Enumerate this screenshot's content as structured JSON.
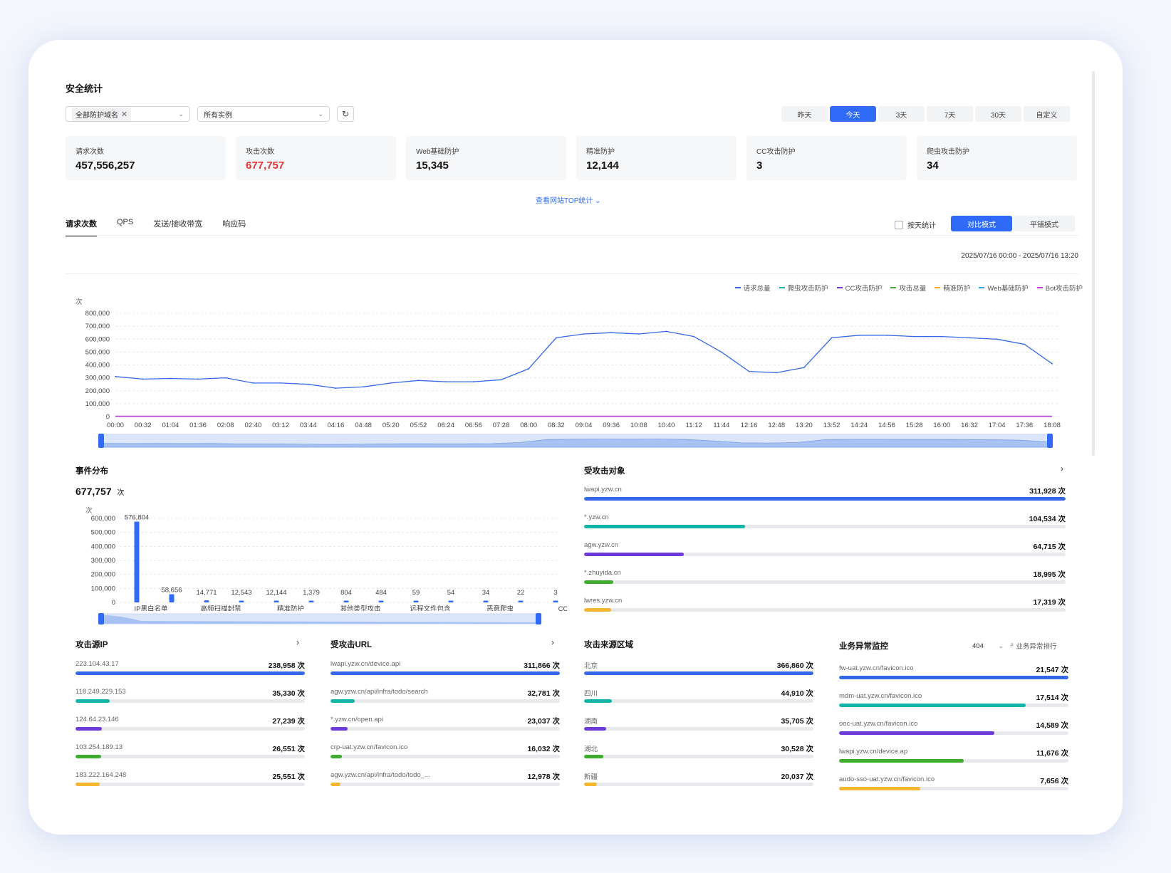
{
  "title": "安全统计",
  "filters": {
    "domain_tag": "全部防护域名",
    "instance": "所有实例"
  },
  "ranges": [
    {
      "label": "昨天",
      "active": false
    },
    {
      "label": "今天",
      "active": true
    },
    {
      "label": "3天",
      "active": false
    },
    {
      "label": "7天",
      "active": false
    },
    {
      "label": "30天",
      "active": false
    },
    {
      "label": "自定义",
      "active": false
    }
  ],
  "cards": [
    {
      "label": "请求次数",
      "value": "457,556,257",
      "red": false
    },
    {
      "label": "攻击次数",
      "value": "677,757",
      "red": true
    },
    {
      "label": "Web基础防护",
      "value": "15,345",
      "red": false
    },
    {
      "label": "精准防护",
      "value": "12,144",
      "red": false
    },
    {
      "label": "CC攻击防护",
      "value": "3",
      "red": false
    },
    {
      "label": "爬虫攻击防护",
      "value": "34",
      "red": false
    }
  ],
  "top_link": "查看网站TOP统计 ⌄",
  "tabs": [
    {
      "label": "请求次数",
      "active": true
    },
    {
      "label": "QPS",
      "active": false
    },
    {
      "label": "发送/接收带宽",
      "active": false
    },
    {
      "label": "响应码",
      "active": false
    }
  ],
  "by_day_label": "按天统计",
  "modes": [
    {
      "label": "对比模式",
      "active": true
    },
    {
      "label": "平铺模式",
      "active": false
    }
  ],
  "date_range": "2025/07/16 00:00 - 2025/07/16 13:20",
  "colors": {
    "accent": "#2f6bf6",
    "red": "#e23535"
  },
  "chart_data": [
    {
      "type": "line",
      "ylabel": "次",
      "ylim": [
        0,
        800000
      ],
      "yticks": [
        "800,000",
        "700,000",
        "600,000",
        "500,000",
        "400,000",
        "300,000",
        "200,000",
        "100,000",
        "0"
      ],
      "categories": [
        "00:00",
        "00:32",
        "01:04",
        "01:36",
        "02:08",
        "02:40",
        "03:12",
        "03:44",
        "04:16",
        "04:48",
        "05:20",
        "05:52",
        "06:24",
        "06:56",
        "07:28",
        "08:00",
        "08:32",
        "09:04",
        "09:36",
        "10:08",
        "10:40",
        "11:12",
        "11:44",
        "12:16",
        "12:48",
        "13:20",
        "13:52",
        "14:24",
        "14:56",
        "15:28",
        "16:00",
        "16:32",
        "17:04",
        "17:36",
        "18:08"
      ],
      "legend": [
        {
          "name": "请求总量",
          "color": "#3568e8"
        },
        {
          "name": "爬虫攻击防护",
          "color": "#13b5a8"
        },
        {
          "name": "CC攻击防护",
          "color": "#6c3bd8"
        },
        {
          "name": "攻击总量",
          "color": "#3fae2f"
        },
        {
          "name": "精准防护",
          "color": "#f5a623"
        },
        {
          "name": "Web基础防护",
          "color": "#2fa6e8"
        },
        {
          "name": "Bot攻击防护",
          "color": "#c33bd8"
        }
      ],
      "series": [
        {
          "name": "请求总量",
          "values": [
            310000,
            290000,
            295000,
            290000,
            300000,
            260000,
            260000,
            250000,
            220000,
            230000,
            260000,
            280000,
            270000,
            270000,
            285000,
            370000,
            610000,
            640000,
            650000,
            640000,
            660000,
            620000,
            500000,
            350000,
            340000,
            380000,
            610000,
            630000,
            630000,
            620000,
            620000,
            610000,
            600000,
            560000,
            410000
          ]
        },
        {
          "name": "攻击总量",
          "values": [
            2000,
            2000,
            2000,
            2000,
            2000,
            2000,
            2000,
            2000,
            2000,
            2000,
            2000,
            2000,
            2000,
            2000,
            2000,
            2000,
            2000,
            2000,
            2000,
            2000,
            2000,
            2000,
            2000,
            2000,
            2000,
            2000,
            2000,
            2000,
            2000,
            2000,
            2000,
            2000,
            2000,
            2000,
            2000
          ]
        }
      ]
    },
    {
      "type": "bar",
      "title": "事件分布",
      "total": "677,757",
      "total_unit": "次",
      "ylabel": "次",
      "ylim": [
        0,
        600000
      ],
      "yticks": [
        "600,000",
        "500,000",
        "400,000",
        "300,000",
        "200,000",
        "100,000",
        "0"
      ],
      "categories": [
        "IP黑白名单",
        "",
        "高频扫描封禁",
        "",
        "精准防护",
        "",
        "其他类型攻击",
        "",
        "远程文件包含",
        "",
        "恶意爬虫",
        "",
        "CC攻击"
      ],
      "values": [
        576804,
        58656,
        14771,
        12543,
        12144,
        1379,
        804,
        484,
        59,
        54,
        34,
        22,
        3
      ],
      "labels": [
        "576,804",
        "58,656",
        "14,771",
        "12,543",
        "12,144",
        "1,379",
        "804",
        "484",
        "59",
        "54",
        "34",
        "22",
        "3"
      ]
    }
  ],
  "attacked_targets": {
    "title": "受攻击对象",
    "items": [
      {
        "label": "lwapi.yzw.cn",
        "value": "311,928 次",
        "ratio": 1.0,
        "color": "#3568e8"
      },
      {
        "label": "*.yzw.cn",
        "value": "104,534 次",
        "ratio": 0.335,
        "color": "#13b5a8"
      },
      {
        "label": "agw.yzw.cn",
        "value": "64,715 次",
        "ratio": 0.207,
        "color": "#6c3bd8"
      },
      {
        "label": "*.zhuyida.cn",
        "value": "18,995 次",
        "ratio": 0.061,
        "color": "#3fae2f"
      },
      {
        "label": "lwres.yzw.cn",
        "value": "17,319 次",
        "ratio": 0.056,
        "color": "#f5b731"
      }
    ]
  },
  "source_ip": {
    "title": "攻击源IP",
    "items": [
      {
        "label": "223.104.43.17",
        "value": "238,958 次",
        "ratio": 1.0,
        "color": "#3568e8"
      },
      {
        "label": "118.249.229.153",
        "value": "35,330 次",
        "ratio": 0.148,
        "color": "#13b5a8"
      },
      {
        "label": "124.64.23.146",
        "value": "27,239 次",
        "ratio": 0.114,
        "color": "#6c3bd8"
      },
      {
        "label": "103.254.189.13",
        "value": "26,551 次",
        "ratio": 0.111,
        "color": "#3fae2f"
      },
      {
        "label": "183.222.164.248",
        "value": "25,551 次",
        "ratio": 0.107,
        "color": "#f5b731"
      }
    ]
  },
  "attacked_url": {
    "title": "受攻击URL",
    "items": [
      {
        "label": "lwapi.yzw.cn/device.api",
        "value": "311,866 次",
        "ratio": 1.0,
        "color": "#3568e8"
      },
      {
        "label": "agw.yzw.cn/api/infra/todo/search",
        "value": "32,781 次",
        "ratio": 0.105,
        "color": "#13b5a8"
      },
      {
        "label": "*.yzw.cn/open.api",
        "value": "23,037 次",
        "ratio": 0.074,
        "color": "#6c3bd8"
      },
      {
        "label": "crp-uat.yzw.cn/favicon.ico",
        "value": "16,032 次",
        "ratio": 0.051,
        "color": "#3fae2f"
      },
      {
        "label": "agw.yzw.cn/api/infra/todo/todo_...",
        "value": "12,978 次",
        "ratio": 0.042,
        "color": "#f5b731"
      }
    ]
  },
  "source_region": {
    "title": "攻击来源区域",
    "items": [
      {
        "label": "北京",
        "value": "366,860 次",
        "ratio": 1.0,
        "color": "#3568e8"
      },
      {
        "label": "四川",
        "value": "44,910 次",
        "ratio": 0.122,
        "color": "#13b5a8"
      },
      {
        "label": "湖南",
        "value": "35,705 次",
        "ratio": 0.097,
        "color": "#6c3bd8"
      },
      {
        "label": "湖北",
        "value": "30,528 次",
        "ratio": 0.083,
        "color": "#3fae2f"
      },
      {
        "label": "新疆",
        "value": "20,037 次",
        "ratio": 0.055,
        "color": "#f5b731"
      }
    ]
  },
  "biz_monitor": {
    "title": "业务异常监控",
    "code": "404",
    "rank_link": "业务异常排行",
    "items": [
      {
        "label": "fw-uat.yzw.cn/favicon.ico",
        "value": "21,547 次",
        "ratio": 1.0,
        "color": "#3568e8"
      },
      {
        "label": "mdm-uat.yzw.cn/favicon.ico",
        "value": "17,514 次",
        "ratio": 0.813,
        "color": "#13b5a8"
      },
      {
        "label": "ooc-uat.yzw.cn/favicon.ico",
        "value": "14,589 次",
        "ratio": 0.677,
        "color": "#6c3bd8"
      },
      {
        "label": "lwapi.yzw.cn/device.ap",
        "value": "11,676 次",
        "ratio": 0.542,
        "color": "#3fae2f"
      },
      {
        "label": "audo-sso-uat.yzw.cn/favicon.ico",
        "value": "7,656 次",
        "ratio": 0.355,
        "color": "#f5b731"
      }
    ]
  }
}
